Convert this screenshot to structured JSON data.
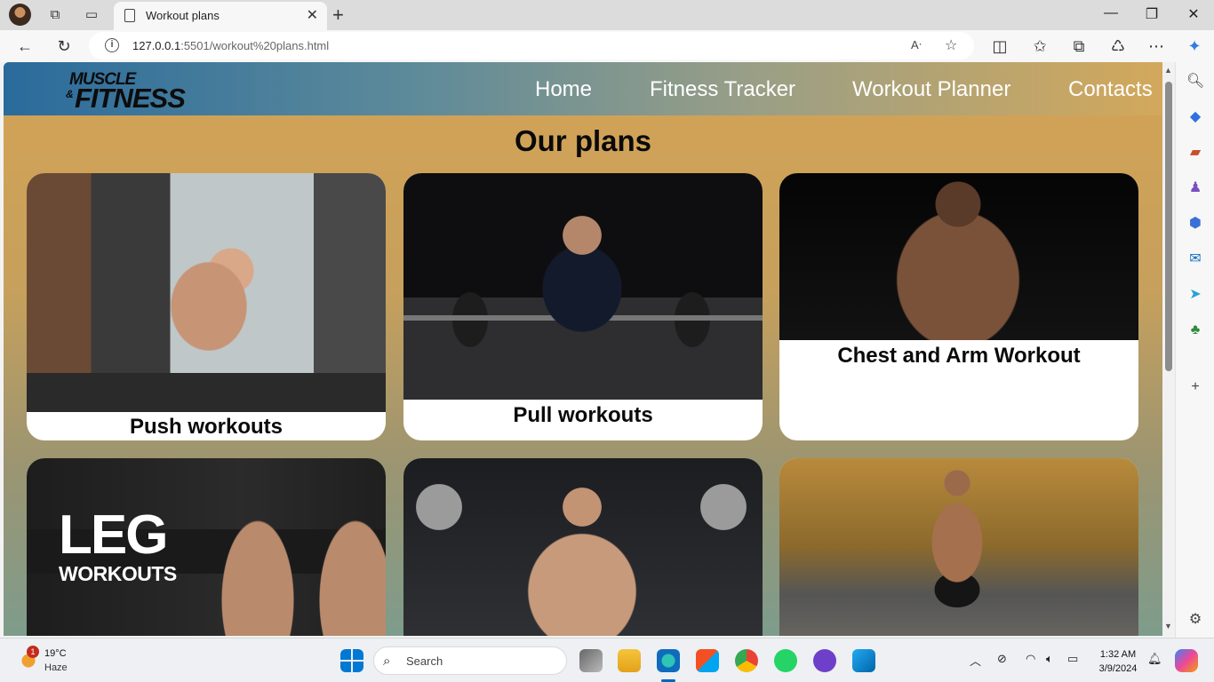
{
  "browser": {
    "tab_title": "Workout plans",
    "url_host": "127.0.0.1",
    "url_rest": ":5501/workout%20plans.html"
  },
  "site": {
    "logo_line1": "MUSCLE",
    "logo_amp": "&",
    "logo_line2": "FITNESS",
    "nav": [
      "Home",
      "Fitness Tracker",
      "Workout Planner",
      "Contacts"
    ],
    "page_title": "Our plans",
    "cards": [
      {
        "caption": "Push workouts"
      },
      {
        "caption": "Pull workouts"
      },
      {
        "caption": "Chest and Arm Workout"
      },
      {
        "caption": "",
        "image_text_big": "LEG",
        "image_text_small": "WORKOUTS"
      },
      {
        "caption": ""
      },
      {
        "caption": ""
      }
    ]
  },
  "taskbar": {
    "weather_badge": "1",
    "temperature": "19°C",
    "condition": "Haze",
    "search_label": "Search",
    "time": "1:32 AM",
    "date": "3/9/2024"
  },
  "colors": {
    "page_gold": "#d4a355",
    "header_blue": "#2a6b9c",
    "accent": "#0067c0"
  }
}
